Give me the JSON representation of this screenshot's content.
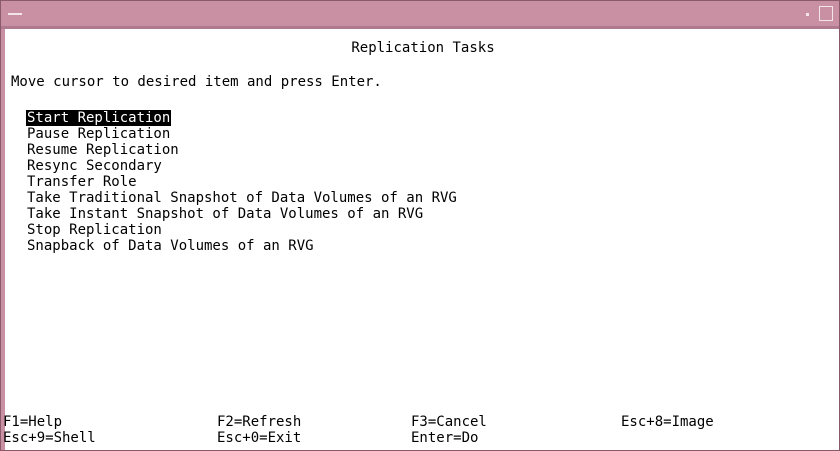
{
  "window": {
    "colors": {
      "titlebar": "#c98fa3",
      "background": "#ffffff",
      "text": "#000000"
    }
  },
  "screen": {
    "title": "Replication Tasks",
    "instructions": "Move cursor to desired item and press Enter."
  },
  "menu": {
    "items": [
      {
        "label": "Start Replication",
        "selected": true
      },
      {
        "label": "Pause Replication"
      },
      {
        "label": "Resume Replication"
      },
      {
        "label": "Resync Secondary"
      },
      {
        "label": "Transfer Role"
      },
      {
        "label": "Take Traditional Snapshot of Data Volumes of an RVG"
      },
      {
        "label": "Take Instant Snapshot of Data Volumes of an RVG"
      },
      {
        "label": "Stop Replication"
      },
      {
        "label": "Snapback of Data Volumes of an RVG"
      }
    ]
  },
  "function_keys": {
    "row1": [
      "F1=Help",
      "F2=Refresh",
      "F3=Cancel",
      "Esc+8=Image"
    ],
    "row2": [
      "Esc+9=Shell",
      "Esc+0=Exit",
      "Enter=Do"
    ]
  }
}
